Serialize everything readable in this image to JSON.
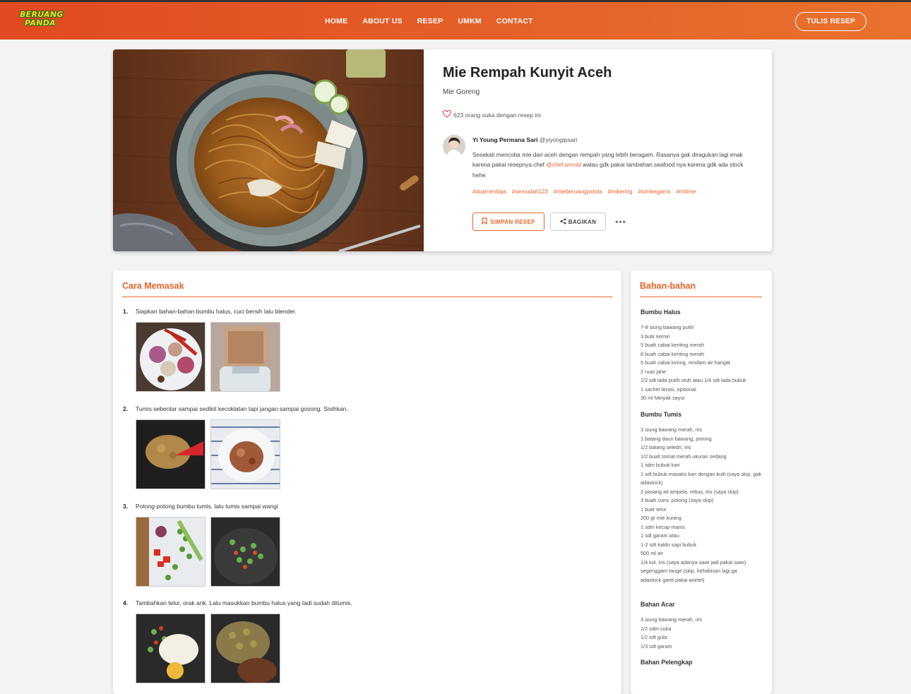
{
  "brand": {
    "line1": "BERUANG",
    "line2": "PANDA"
  },
  "nav": {
    "items": [
      "HOME",
      "ABOUT US",
      "RESEP",
      "UMKM",
      "CONTACT"
    ],
    "cta": "TULIS RESEP"
  },
  "recipe": {
    "title": "Mie Rempah Kunyit Aceh",
    "category": "Mie Goreng",
    "likes": "623 orang suka dengan resep ini",
    "author_name": "Yi Young Permana Sari",
    "author_handle": "@yiyongipsari",
    "desc_before": "Sesekali mencoba mie dari aceh dengan rempah yang lebih beragam. Rasanya gak diragukan lagi enak karena pakai resepnya chef ",
    "desc_mention": "@chef.arnold",
    "desc_after": " walau gdk pakai tambahan seafood nya karena gdk ada stock hehe.",
    "tags": [
      "#duamenitaja",
      "#semudah123",
      "#mieberuangpanda",
      "#mikering",
      "#tomkegams",
      "#mitime"
    ],
    "save_label": "SIMPAN RESEP",
    "share_label": "BAGIKAN",
    "more_label": "•••"
  },
  "steps_section": {
    "heading": "Cara Memasak",
    "steps": [
      {
        "num": "1.",
        "text": "Siapkan bahan-bahan bumbu halus, cuci bersih lalu blender."
      },
      {
        "num": "2.",
        "text": "Tumis sebentar sampai sedikit kecoklatan tapi jangan sampai gosong. Sisihkan."
      },
      {
        "num": "3.",
        "text": "Potong-potong bumbu tumis, lalu tumis sampai wangi"
      },
      {
        "num": "4.",
        "text": "Tambahkan telur, orak arik. Lalu masukkan bumbu halus yang tadi sudah ditumis."
      }
    ]
  },
  "ingredients": {
    "heading": "Bahan-bahan",
    "groups": [
      {
        "title": "Bumbu Halus",
        "items": [
          "7-8 siung bawang putih",
          "3 butir kemiri",
          "5 buah cabai keriting merah",
          "8 buah cabai keriting merah",
          "5 buah cabai kering, rendam air hangat",
          "2 ruas jahe",
          "1/2 sdt lada putih utuh atau 1/4 sdt lada bubuk",
          "1 sachet terasi, opsional",
          "30 ml Minyak sayur"
        ]
      },
      {
        "title": "Bumbu Tumis",
        "items": [
          "3 siung bawang merah, iris",
          "1 batang daun bawang, potong",
          "1/2 batang seledri, iris",
          "1/2 buah tomat merah ukuran sedang",
          "1 sdm bubuk kari",
          "1 sdt bubuk masako kari dengan kulit (saya skip, gak",
          "adastock)",
          "2 pasang ati ampela, rebus, iris (saya skip)",
          "3 buah cumi, potong (saya skip)",
          "1 butir telur",
          "200 gr mie kuning",
          "1 sdm kecap manis",
          "1 sdt garam atau",
          "1-2 sdt kaldu sapi bubuk",
          "500 ml air",
          "1/4 kol, iris (saya adanya sawi jadi pakai sawi)",
          "segenggam tauge (skip, kehabisan lagi ga",
          "adastock ganti pakai wortel)"
        ]
      },
      {
        "title": "Bahan Acar",
        "items": [
          "3 siung bawang merah, iris",
          "1/2 sdm cuka",
          "1/2 sdt gula",
          "1/3 sdt garam"
        ]
      },
      {
        "title": "Bahan Pelengkap",
        "items": []
      }
    ]
  }
}
